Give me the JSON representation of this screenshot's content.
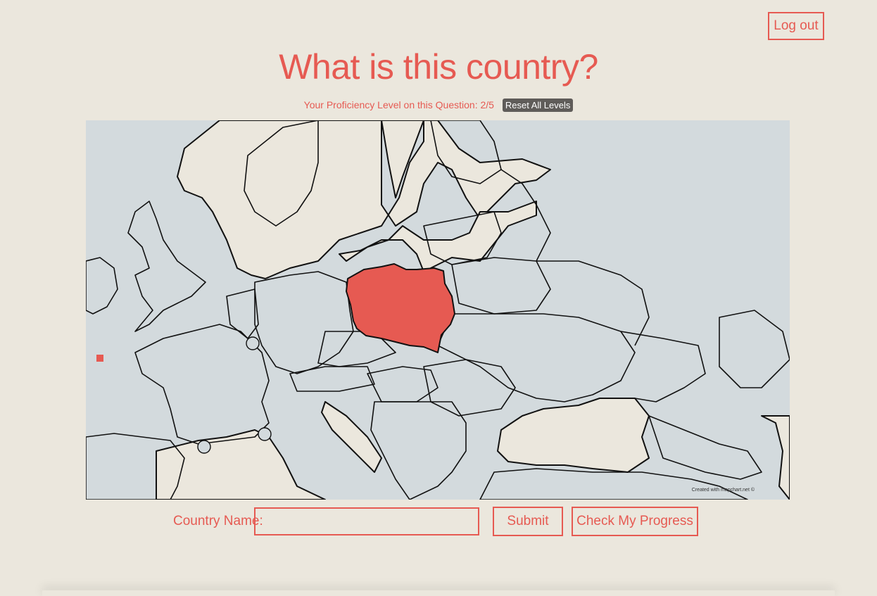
{
  "header": {
    "logout_label": "Log out"
  },
  "question": {
    "title": "What is this country?",
    "proficiency_text": "Your Proficiency Level on this Question: 2/5",
    "reset_label": "Reset All Levels"
  },
  "map": {
    "highlighted_country_color": "#e65a52",
    "land_color": "#d3dadd",
    "water_color": "#ebe7dd",
    "credit": "Created with mapchart.net ©"
  },
  "form": {
    "country_label": "Country Name:",
    "country_value": "",
    "submit_label": "Submit",
    "progress_label": "Check My Progress"
  },
  "colors": {
    "accent": "#e65a52",
    "background": "#ebe7dd"
  }
}
